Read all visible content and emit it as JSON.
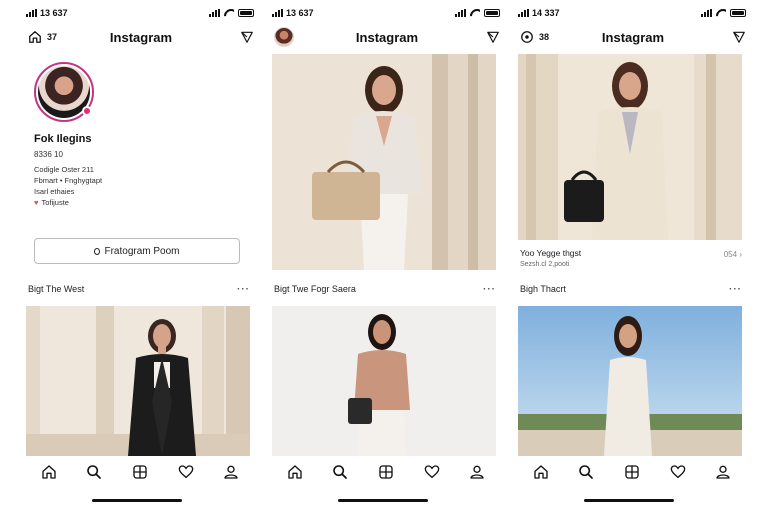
{
  "screens": [
    {
      "status": {
        "time": "13 637"
      },
      "topbar": {
        "title": "Instagram",
        "count": "37"
      },
      "profile": {
        "name": "Fok Ilegins",
        "stats": "8336 10",
        "bio": [
          "Codigle Oster 211",
          "Fbmart • Fnghygtapt",
          "Isarl ethaies"
        ],
        "link": "Tofijuste",
        "button_label": "Fratogram Poom"
      },
      "section": {
        "title": "Bigt The West",
        "more": "···"
      }
    },
    {
      "status": {
        "time": "13 637"
      },
      "topbar": {
        "title": "Instagram"
      },
      "section": {
        "title": "Bigt Twe Fogr Saera",
        "more": "···"
      }
    },
    {
      "status": {
        "time": "14 337"
      },
      "topbar": {
        "title": "Instagram",
        "count": "38"
      },
      "caption": {
        "title": "Yoo Yegge thgst",
        "sub": "Sezsh.cl 2,pooti",
        "count": "054"
      },
      "section": {
        "title": "Bigh Thacrt",
        "more": "···"
      }
    }
  ],
  "bottom_nav": [
    "home-icon",
    "search-icon",
    "reels-icon",
    "heart-icon",
    "profile-icon"
  ],
  "colors": {
    "accent": "#c13584",
    "badge": "#e1306c",
    "text": "#111111"
  }
}
